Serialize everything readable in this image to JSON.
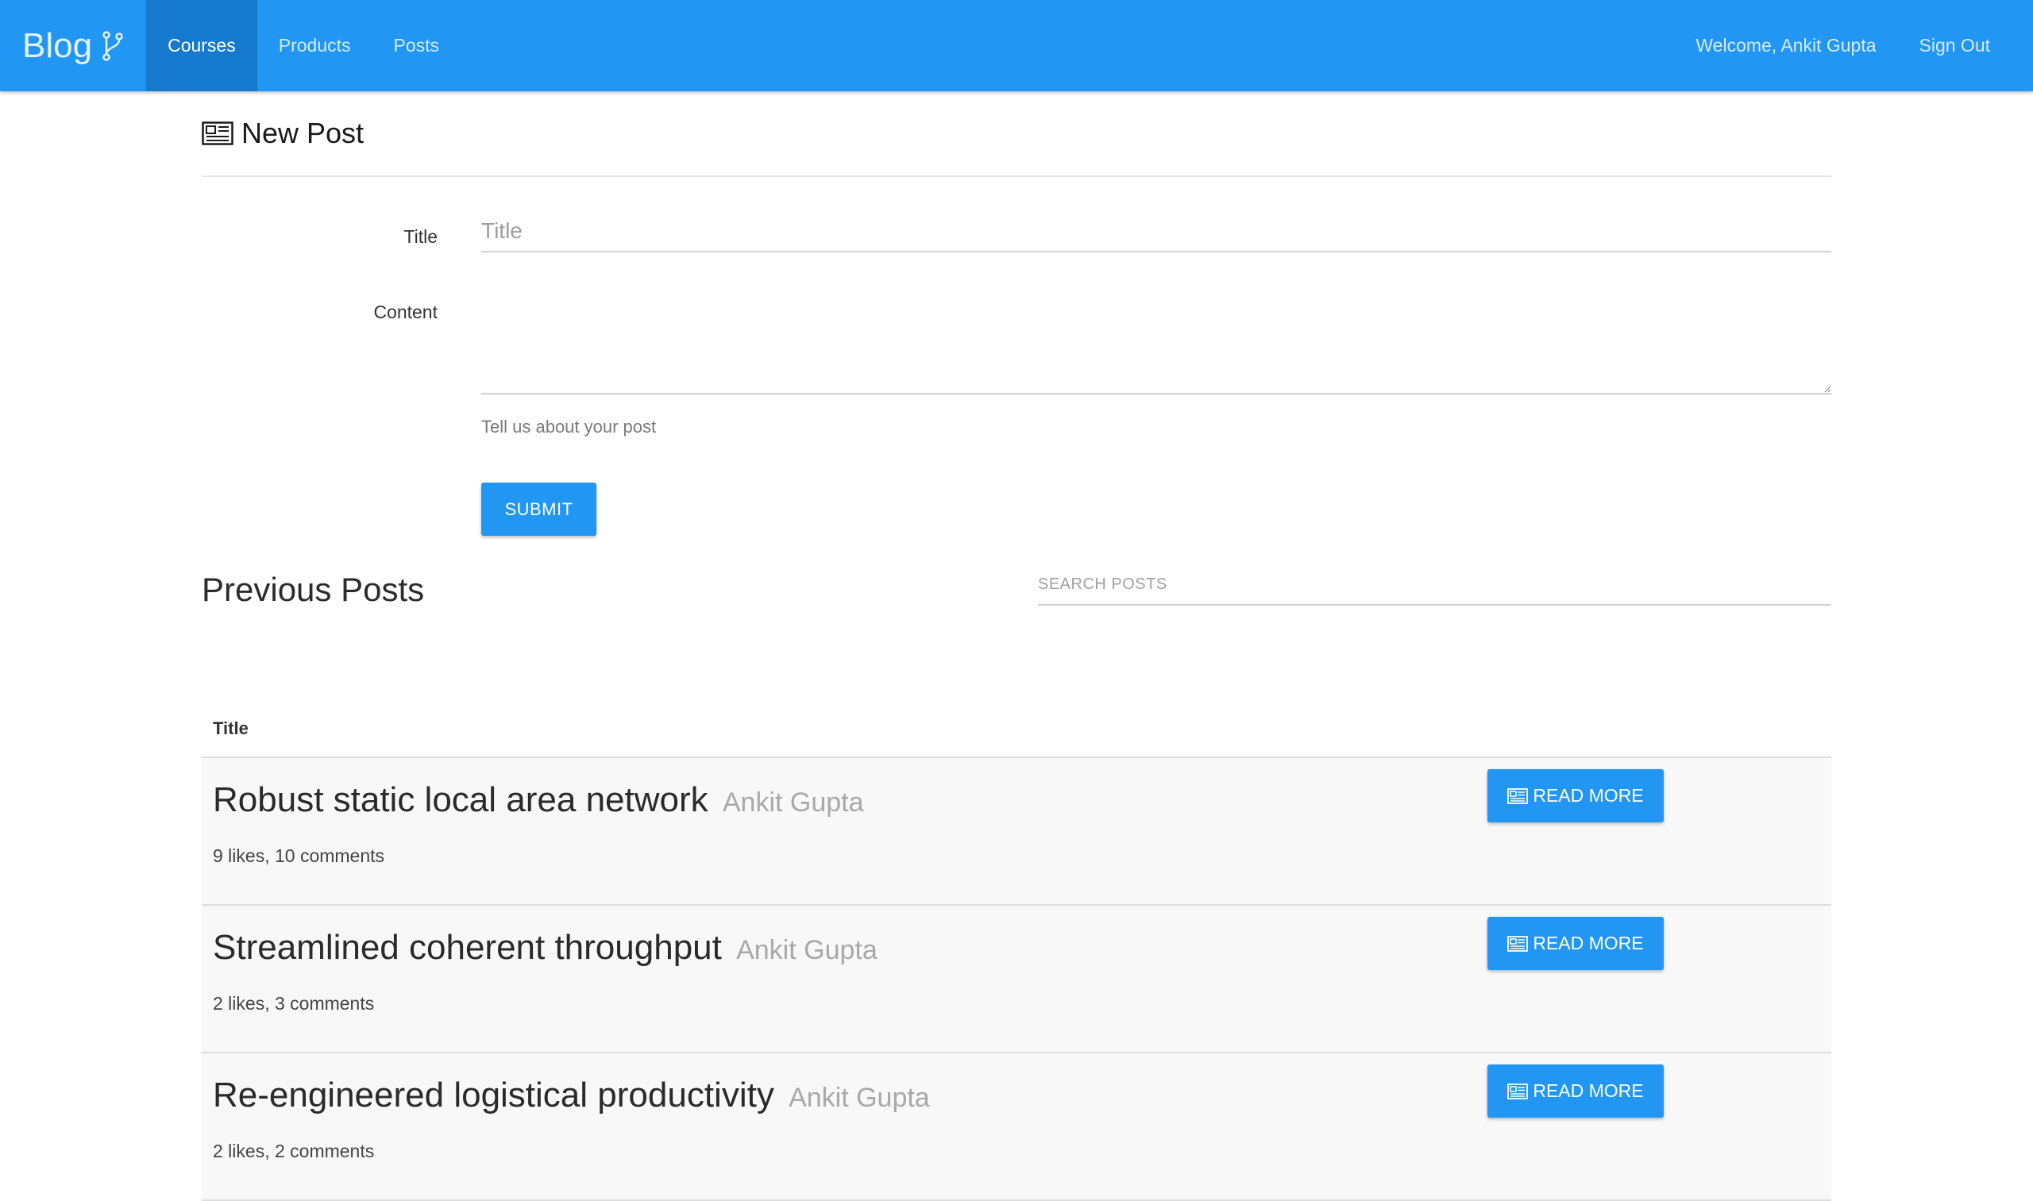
{
  "nav": {
    "brand": "Blog",
    "items": [
      {
        "label": "Courses",
        "active": true
      },
      {
        "label": "Products",
        "active": false
      },
      {
        "label": "Posts",
        "active": false
      }
    ],
    "welcome": "Welcome, Ankit Gupta",
    "sign_out": "Sign Out",
    "brand_icon": "fork-icon",
    "color": "#2196f3",
    "active_color": "#1579ce"
  },
  "new_post": {
    "heading": "New Post",
    "heading_icon": "newspaper-icon",
    "title_label": "Title",
    "title_placeholder": "Title",
    "title_value": "",
    "content_label": "Content",
    "content_value": "",
    "content_help": "Tell us about your post",
    "submit_label": "SUBMIT"
  },
  "previous": {
    "heading": "Previous Posts",
    "search_placeholder": "SEARCH POSTS",
    "column_title": "Title",
    "read_more_label": "READ MORE",
    "read_more_icon": "newspaper-icon",
    "posts": [
      {
        "title": "Robust static local area network",
        "author": "Ankit Gupta",
        "stats": "9 likes, 10 comments"
      },
      {
        "title": "Streamlined coherent throughput",
        "author": "Ankit Gupta",
        "stats": "2 likes, 3 comments"
      },
      {
        "title": "Re-engineered logistical productivity",
        "author": "Ankit Gupta",
        "stats": "2 likes, 2 comments"
      }
    ]
  }
}
